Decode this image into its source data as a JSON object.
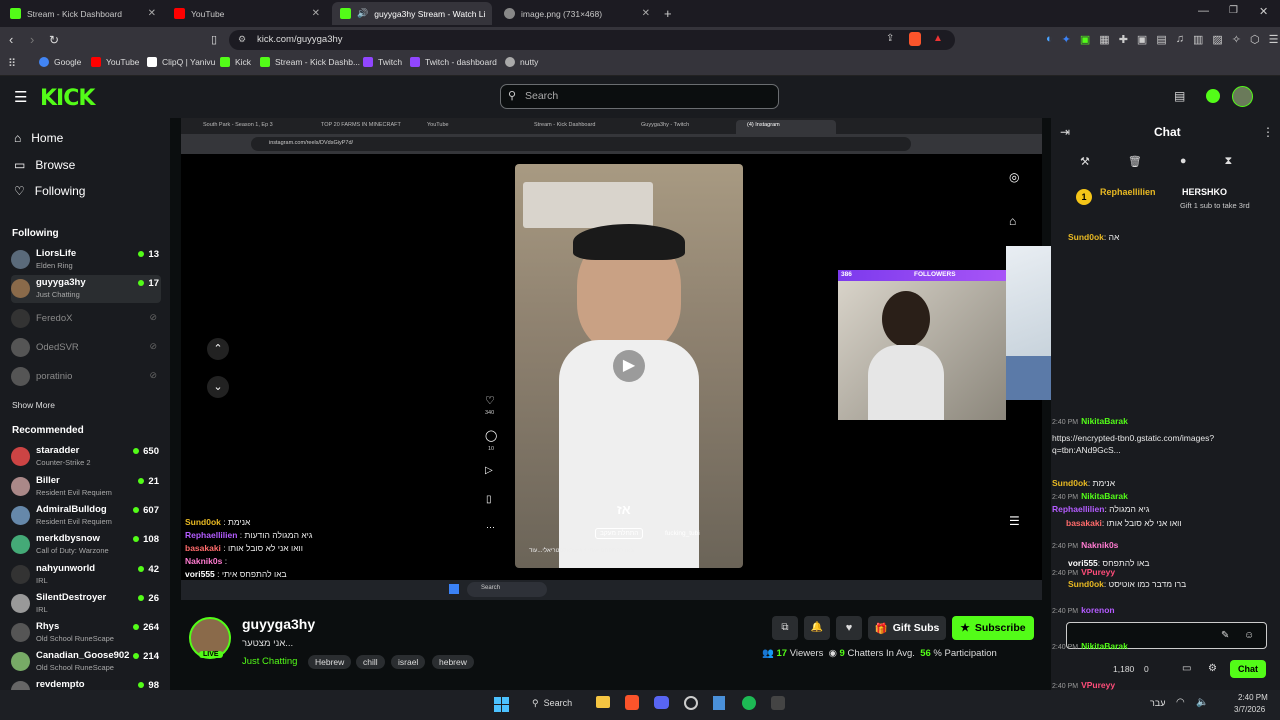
{
  "browser": {
    "tabs": [
      {
        "title": "Stream - Kick Dashboard",
        "color": "#53fc18"
      },
      {
        "title": "YouTube",
        "color": "#ff0000"
      },
      {
        "title": "guyyga3hy Stream - Watch Li",
        "color": "#53fc18"
      },
      {
        "title": "image.png (731×468)",
        "color": "#888888"
      }
    ],
    "url": "kick.com/guyyga3hy",
    "bookmarks": [
      "Google",
      "YouTube",
      "ClipQ | Yanivu",
      "Kick",
      "Stream - Kick Dashb...",
      "Twitch",
      "Twitch - dashboard",
      "nutty"
    ]
  },
  "kick": {
    "search_placeholder": "Search",
    "nav": [
      "Home",
      "Browse",
      "Following"
    ],
    "following_title": "Following",
    "following": [
      {
        "name": "LiorsLife",
        "category": "Elden Ring",
        "viewers": "13",
        "live": true,
        "color": "#5a6a7a"
      },
      {
        "name": "guyyga3hy",
        "category": "Just Chatting",
        "viewers": "17",
        "live": true,
        "color": "#8a6a4a"
      },
      {
        "name": "FeredoX",
        "category": "",
        "viewers": "",
        "live": false,
        "color": "#444"
      },
      {
        "name": "OdedSVR",
        "category": "",
        "viewers": "",
        "live": false,
        "color": "#444"
      },
      {
        "name": "poratinio",
        "category": "",
        "viewers": "",
        "live": false,
        "color": "#444"
      }
    ],
    "show_more": "Show More",
    "recommended_title": "Recommended",
    "recommended": [
      {
        "name": "staradder",
        "category": "Counter-Strike 2",
        "viewers": "650",
        "color": "#c44"
      },
      {
        "name": "Biller",
        "category": "Resident Evil Requiem",
        "viewers": "21",
        "color": "#a88"
      },
      {
        "name": "AdmiralBulldog",
        "category": "Resident Evil Requiem",
        "viewers": "607",
        "color": "#68a"
      },
      {
        "name": "merkdbysnow",
        "category": "Call of Duty: Warzone",
        "viewers": "108",
        "color": "#4a7"
      },
      {
        "name": "nahyunworld",
        "category": "IRL",
        "viewers": "42",
        "color": "#333"
      },
      {
        "name": "SilentDestroyer",
        "category": "IRL",
        "viewers": "26",
        "color": "#999"
      },
      {
        "name": "Rhys",
        "category": "Old School RuneScape",
        "viewers": "264",
        "color": "#555"
      },
      {
        "name": "Canadian_Goose902",
        "category": "Old School RuneScape",
        "viewers": "214",
        "color": "#7a6"
      },
      {
        "name": "revdempto",
        "category": "",
        "viewers": "98",
        "color": "#666"
      }
    ]
  },
  "video": {
    "inner_tabs": [
      "South Park - Season 1, Ep 3",
      "TOP 20 FARMS IN MINECRAFT",
      "YouTube",
      "Stream - Kick Dashboard",
      "Guyyga3hy - Twitch",
      "(4) Instagram"
    ],
    "inner_url": "instagram.com/reels/DVdsGiyP7d/",
    "reel_caption": "אז",
    "reel_user": "fucking_tubi",
    "reel_follow": "התחלת מעקב",
    "reel_desc": "באו להתפחס איתי • #ישראלסטריאלי...עוד",
    "reel_likes": "340",
    "reel_comments": "10",
    "followers_count": "386",
    "followers_label": "FOLLOWERS",
    "overlay_chat": [
      {
        "user": "Sund0ok",
        "text": "אנימת",
        "color": "#e8b923"
      },
      {
        "user": "Rephaellilien",
        "text": "גיא המגולה הודעות",
        "color": "#b45cff"
      },
      {
        "user": "basakaki",
        "text": "וואו אני לא סובל אותו",
        "color": "#ff6b6b"
      },
      {
        "user": "Naknik0s",
        "text": "",
        "color": "#ff7bd0"
      },
      {
        "user": "vori555",
        "text": "באו להתפחס איתי",
        "color": "#fff"
      }
    ],
    "inner_taskbar_search": "Search"
  },
  "stream": {
    "name": "guyyga3hy",
    "title": "אני מצטער...",
    "category": "Just Chatting",
    "tags": [
      "Hebrew",
      "chill",
      "israel",
      "hebrew"
    ],
    "live_badge": "LIVE",
    "gift_subs": "Gift Subs",
    "subscribe": "Subscribe",
    "viewers": "17",
    "viewers_label": "Viewers",
    "chatters": "9",
    "chatters_label": "Chatters In Avg.",
    "participation": "56",
    "participation_label": "% Participation"
  },
  "chat": {
    "title": "Chat",
    "pinned_user": "Rephaellilien",
    "pinned_gift_to": "HERSHKO",
    "pinned_text": "Gift 1 sub to take 3rd",
    "pinned_count": "1",
    "first_line_user": "Sund0ok",
    "first_line_text": "אה",
    "lines": [
      {
        "time": "2:40 PM",
        "user": "NikitaBarak",
        "text": "",
        "color": "#53fc18"
      },
      {
        "time": "",
        "user": "",
        "text": "https://encrypted-tbn0.gstatic.com/images?q=tbn:ANd9GcS...",
        "color": "#ddd"
      },
      {
        "time": "",
        "user": "Sund0ok",
        "text": "אנימת",
        "color": "#e8b923"
      },
      {
        "time": "2:40 PM",
        "user": "NikitaBarak",
        "text": "",
        "color": "#53fc18"
      },
      {
        "time": "",
        "user": "Rephaellilien",
        "text": "גיא המגולה",
        "color": "#b45cff"
      },
      {
        "time": "",
        "user": "basakaki",
        "text": "וואו אני לא סובל אותו",
        "color": "#ff6b6b"
      },
      {
        "time": "2:40 PM",
        "user": "Naknik0s",
        "text": "",
        "color": "#ff7bd0"
      },
      {
        "time": "",
        "user": "vori555",
        "text": "באו להתפחס",
        "color": "#fff"
      },
      {
        "time": "2:40 PM",
        "user": "VPureyy",
        "text": "",
        "color": "#ff4d7a"
      },
      {
        "time": "",
        "user": "Sund0ok",
        "text": "ברו מדבר כמו אוטיסט",
        "color": "#e8b923"
      },
      {
        "time": "2:40 PM",
        "user": "korenon",
        "text": "",
        "color": "#b45cff"
      },
      {
        "time": "2:40 PM",
        "user": "NikitaBarak",
        "text": "",
        "color": "#53fc18"
      },
      {
        "time": "2:40 PM",
        "user": "VPureyy",
        "text": "",
        "color": "#ff4d7a"
      }
    ],
    "chat_button": "Chat",
    "points": "1,180",
    "points2": "0"
  },
  "taskbar": {
    "search": "Search",
    "time": "2:40 PM",
    "date": "3/7/2026",
    "lang": "עבר"
  }
}
